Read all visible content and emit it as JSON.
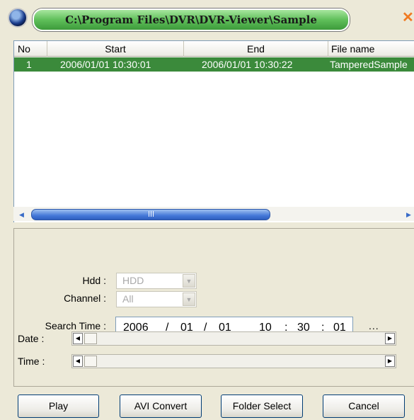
{
  "window": {
    "title": "C:\\Program Files\\DVR\\DVR-Viewer\\Sample",
    "close_glyph": "✕",
    "app_icon": "app-globe-icon",
    "accent": "#3b8a3b"
  },
  "file_list": {
    "columns": [
      "No",
      "Start",
      "End",
      "File name"
    ],
    "rows": [
      {
        "no": "1",
        "start": "2006/01/01  10:30:01",
        "end": "2006/01/01  10:30:22",
        "file_name": "TamperedSample"
      }
    ]
  },
  "search": {
    "hdd_label": "Hdd :",
    "hdd_value": "HDD",
    "channel_label": "Channel :",
    "channel_value": "All",
    "search_time_label": "Search Time :",
    "time": {
      "year": "2006",
      "month": "01",
      "day": "01",
      "hour": "10",
      "minute": "30",
      "second": "01"
    },
    "sep_date": "/",
    "sep_time": ":",
    "browse_label": "...",
    "date_label": "Date :",
    "time_label": "Time :"
  },
  "buttons": {
    "play": "Play",
    "avi_convert": "AVI Convert",
    "folder_select": "Folder Select",
    "cancel": "Cancel"
  }
}
